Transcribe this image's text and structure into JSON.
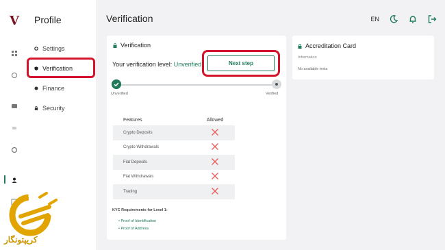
{
  "colors": {
    "accent": "#1f7a5a",
    "highlight": "#d4142a",
    "brand": "#7a1020",
    "watermark": "#e2a400"
  },
  "rail": {
    "logo": "V",
    "icons": [
      "dashboard-icon",
      "bolt-icon",
      "wallet-icon",
      "swap-icon",
      "globe-icon",
      "user-icon",
      "grid-icon"
    ]
  },
  "sidebar": {
    "title": "Profile",
    "items": [
      {
        "label": "Settings",
        "icon": "gear-icon"
      },
      {
        "label": "Verification",
        "icon": "shield-icon",
        "active": true
      },
      {
        "label": "Finance",
        "icon": "coin-icon"
      },
      {
        "label": "Security",
        "icon": "lock-icon"
      }
    ]
  },
  "header": {
    "title": "Verification",
    "language": "EN",
    "icons": [
      "moon-icon",
      "bell-icon",
      "logout-icon"
    ]
  },
  "verification": {
    "title": "Verification",
    "level_label": "Your verification level:",
    "level_value": "Unverified",
    "next_step": "Next step",
    "progress": {
      "start_label": "Unverified",
      "end_label": "Verified",
      "completed_steps": 1,
      "total_steps": 2
    },
    "table": {
      "headers": [
        "Features",
        "Allowed"
      ],
      "rows": [
        {
          "feature": "Crypto Deposits",
          "allowed": false
        },
        {
          "feature": "Crypto Withdrawals",
          "allowed": false
        },
        {
          "feature": "Fiat Deposits",
          "allowed": false
        },
        {
          "feature": "Fiat Withdrawals",
          "allowed": false
        },
        {
          "feature": "Trading",
          "allowed": false
        }
      ]
    },
    "kyc_title": "KYC Requirements for Level 1:",
    "kyc_items": [
      "Proof of Identification",
      "Proof of Address"
    ]
  },
  "accreditation": {
    "title": "Accreditation Card",
    "subtitle": "Information",
    "empty": "No available tests"
  },
  "watermark": {
    "text": "کریپتونگار"
  }
}
